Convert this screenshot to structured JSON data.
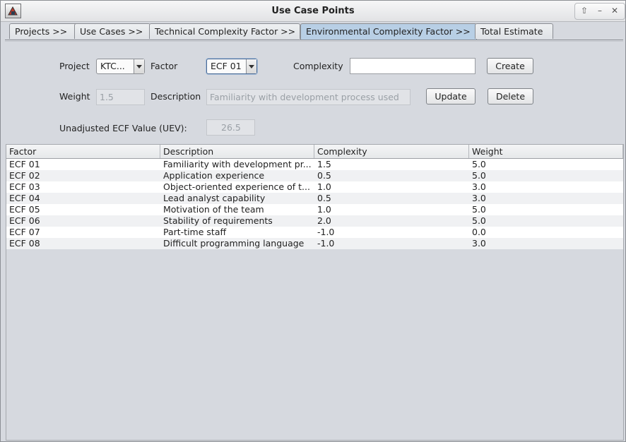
{
  "window": {
    "title": "Use Case Points"
  },
  "tabs": [
    {
      "label": "Projects >>"
    },
    {
      "label": "Use Cases >>"
    },
    {
      "label": "Technical Complexity Factor >>"
    },
    {
      "label": "Environmental Complexity Factor >>"
    },
    {
      "label": "Total Estimate"
    }
  ],
  "form": {
    "project_label": "Project",
    "project_value": "KTC...",
    "factor_label": "Factor",
    "factor_value": "ECF 01",
    "complexity_label": "Complexity",
    "complexity_value": "",
    "create_label": "Create",
    "weight_label": "Weight",
    "weight_value": "1.5",
    "description_label": "Description",
    "description_value": "Familiarity with development process used",
    "update_label": "Update",
    "delete_label": "Delete",
    "uev_label": "Unadjusted ECF Value (UEV):",
    "uev_value": "26.5"
  },
  "table": {
    "columns": [
      "Factor",
      "Description",
      "Complexity",
      "Weight"
    ],
    "rows": [
      [
        "ECF 01",
        "Familiarity with development pr...",
        "1.5",
        "5.0"
      ],
      [
        "ECF 02",
        "Application experience",
        "0.5",
        "5.0"
      ],
      [
        "ECF 03",
        "Object-oriented experience of t...",
        "1.0",
        "3.0"
      ],
      [
        "ECF 04",
        "Lead analyst capability",
        "0.5",
        "3.0"
      ],
      [
        "ECF 05",
        "Motivation of the team",
        "1.0",
        "5.0"
      ],
      [
        "ECF 06",
        "Stability of requirements",
        "2.0",
        "5.0"
      ],
      [
        "ECF 07",
        "Part-time staff",
        "-1.0",
        "0.0"
      ],
      [
        "ECF 08",
        "Difficult programming language",
        "-1.0",
        "3.0"
      ]
    ]
  }
}
